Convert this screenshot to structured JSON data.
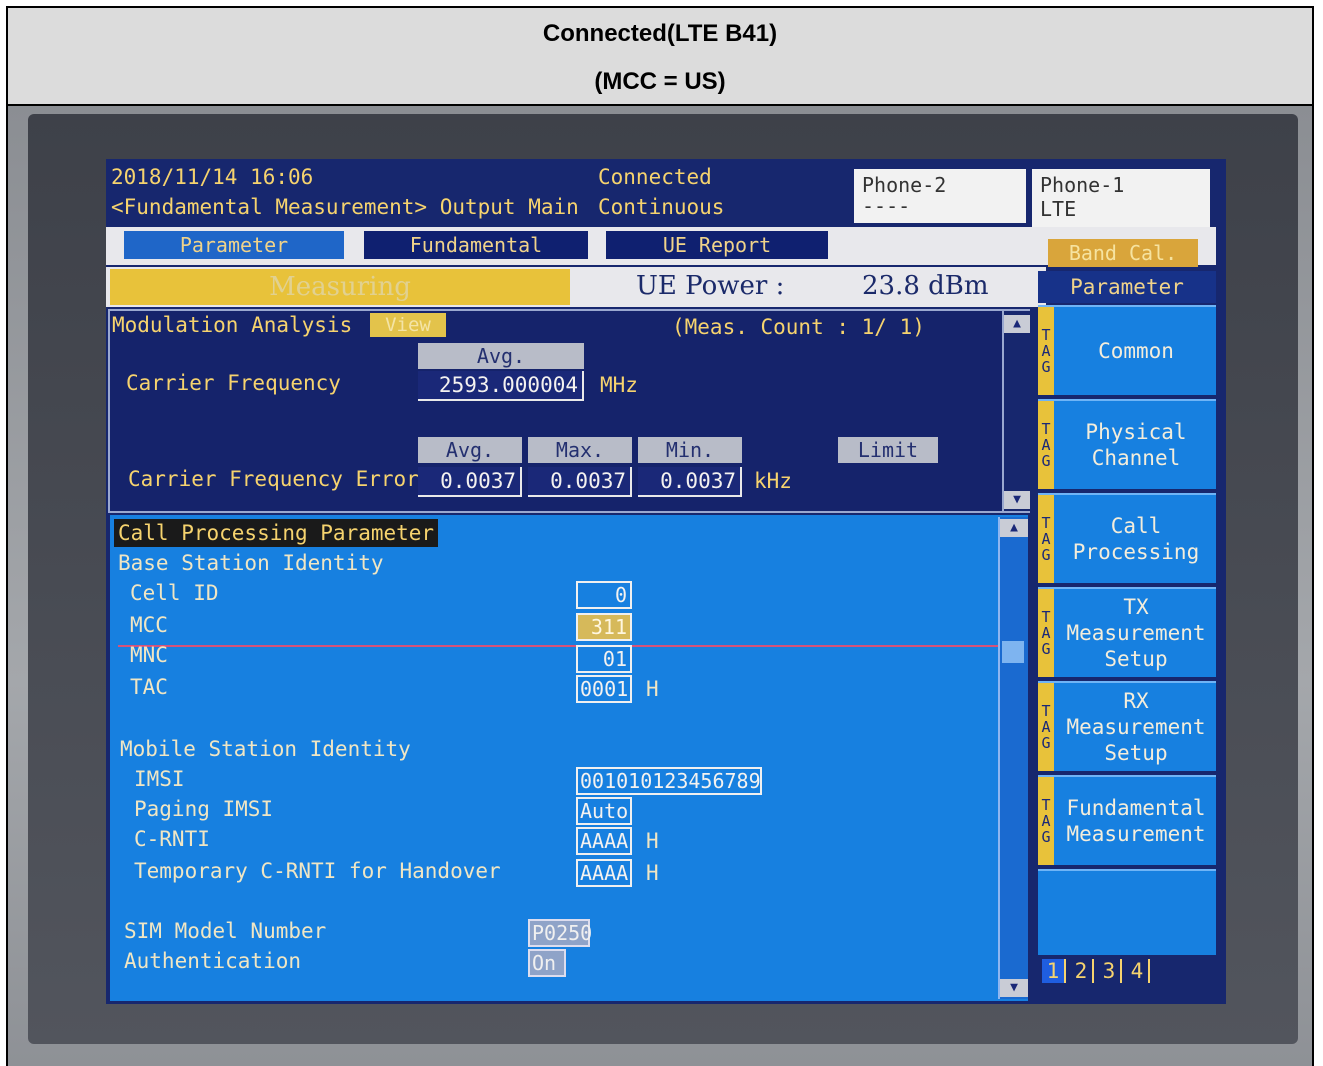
{
  "caption": {
    "line1": "Connected(LTE B41)",
    "line2": "(MCC = US)"
  },
  "header": {
    "datetime": "2018/11/14 16:06",
    "screen": "<Fundamental Measurement> Output Main",
    "status": "Connected",
    "mode": "Continuous",
    "phone2": {
      "label": "Phone-2",
      "value": "----"
    },
    "phone1": {
      "label": "Phone-1",
      "value": "LTE"
    }
  },
  "tabs": [
    "Parameter",
    "Fundamental",
    "UE Report"
  ],
  "band_cal": "Band Cal.",
  "measuring": "Measuring",
  "ue_power": {
    "label": "UE Power :",
    "value": "23.8 dBm"
  },
  "mod": {
    "title": "Modulation Analysis",
    "view": "View",
    "meas_count": "(Meas. Count :     1/     1)",
    "avg_header": "Avg.",
    "carrier_freq": {
      "label": "Carrier Frequency",
      "value": "2593.000004",
      "unit": "MHz"
    },
    "headers": [
      "Avg.",
      "Max.",
      "Min.",
      "Limit"
    ],
    "cfe": {
      "label": "Carrier Frequency Error",
      "values": [
        "0.0037",
        "0.0037",
        "0.0037"
      ],
      "unit": "kHz"
    }
  },
  "cp": {
    "title": "Call Processing Parameter",
    "bs_identity": "Base Station Identity",
    "cell_id": {
      "label": "Cell ID",
      "value": "0"
    },
    "mcc": {
      "label": "MCC",
      "value": "311"
    },
    "mnc": {
      "label": "MNC",
      "value": "01"
    },
    "tac": {
      "label": "TAC",
      "value": "0001",
      "unit": "H"
    },
    "ms_identity": "Mobile Station Identity",
    "imsi": {
      "label": "IMSI",
      "value": "001010123456789"
    },
    "paging_imsi": {
      "label": "Paging IMSI",
      "value": "Auto"
    },
    "crnti": {
      "label": "C-RNTI",
      "value": "AAAA",
      "unit": "H"
    },
    "temp_crnti": {
      "label": "Temporary C-RNTI for Handover",
      "value": "AAAA",
      "unit": "H"
    },
    "sim_model": {
      "label": "SIM Model Number",
      "value": "P0250"
    },
    "auth": {
      "label": "Authentication",
      "value": "On"
    }
  },
  "side": {
    "header": "Parameter",
    "tag": "TAG",
    "buttons": [
      "Common",
      "Physical\nChannel",
      "Call\nProcessing",
      "TX\nMeasurement\nSetup",
      "RX\nMeasurement\nSetup",
      "Fundamental\nMeasurement"
    ],
    "pages": [
      "1",
      "2",
      "3",
      "4"
    ]
  },
  "colors": {
    "screen_bg": "#17276e",
    "panel_blue": "#1780e0",
    "text_yellow": "#f6d36e"
  }
}
